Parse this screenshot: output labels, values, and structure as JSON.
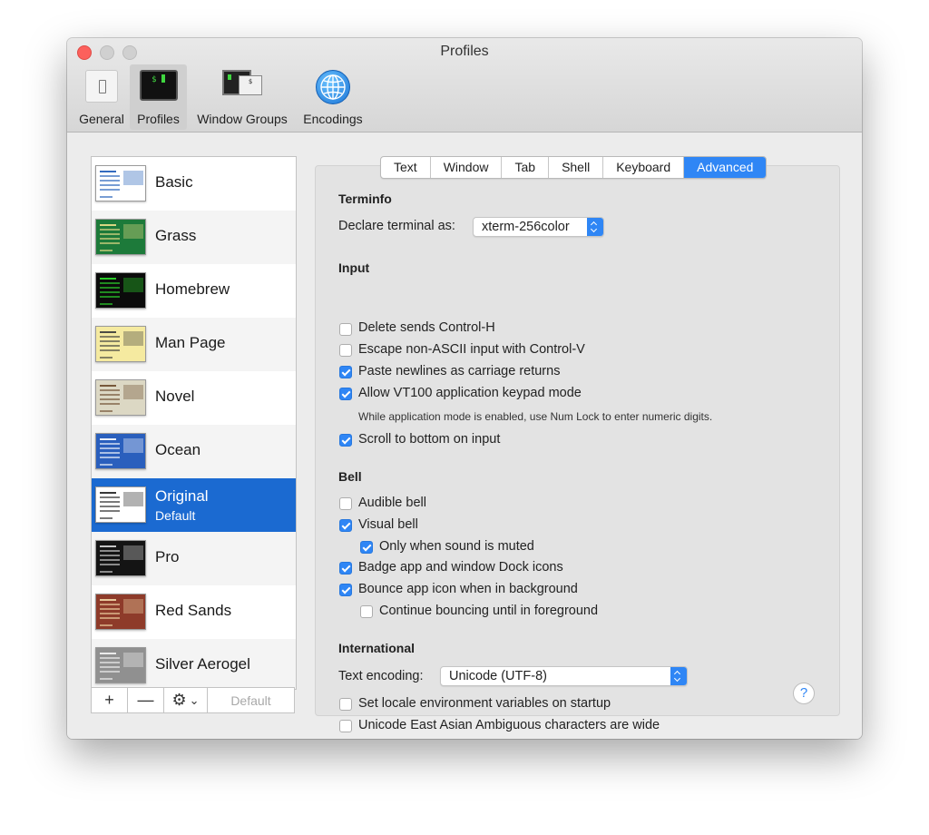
{
  "window": {
    "title": "Profiles"
  },
  "toolbar": {
    "items": [
      {
        "label": "General",
        "icon": "general-icon"
      },
      {
        "label": "Profiles",
        "icon": "terminal-icon",
        "selected": true
      },
      {
        "label": "Window Groups",
        "icon": "window-groups-icon"
      },
      {
        "label": "Encodings",
        "icon": "globe-icon"
      }
    ],
    "profiles_icon_text": "$",
    "window_groups_icon_text": "$"
  },
  "profiles": [
    {
      "name": "Basic",
      "bg": "#ffffff",
      "fg": "#1e5bb8"
    },
    {
      "name": "Grass",
      "bg": "#1d7a3a",
      "fg": "#f0e08a"
    },
    {
      "name": "Homebrew",
      "bg": "#0b0b0b",
      "fg": "#2ee02e"
    },
    {
      "name": "Man Page",
      "bg": "#f5eaa0",
      "fg": "#3b3b3b"
    },
    {
      "name": "Novel",
      "bg": "#dcd8c4",
      "fg": "#6b4a2b"
    },
    {
      "name": "Ocean",
      "bg": "#2a5fbd",
      "fg": "#ffffff"
    },
    {
      "name": "Original",
      "sub": "Default",
      "bg": "#ffffff",
      "fg": "#222222",
      "selected": true
    },
    {
      "name": "Pro",
      "bg": "#141414",
      "fg": "#d8d8d8"
    },
    {
      "name": "Red Sands",
      "bg": "#8e3b2a",
      "fg": "#f1d9a8"
    },
    {
      "name": "Silver Aerogel",
      "bg": "#909090",
      "fg": "#f5f5f5"
    }
  ],
  "list_tools": {
    "add": "+",
    "remove": "—",
    "gear": "⚙",
    "chevron": "⌄",
    "default_label": "Default"
  },
  "tabs": [
    {
      "label": "Text"
    },
    {
      "label": "Window"
    },
    {
      "label": "Tab"
    },
    {
      "label": "Shell"
    },
    {
      "label": "Keyboard"
    },
    {
      "label": "Advanced",
      "active": true
    }
  ],
  "terminfo": {
    "heading": "Terminfo",
    "declare_label": "Declare terminal as:",
    "declare_value": "xterm-256color"
  },
  "input": {
    "heading": "Input",
    "options": [
      {
        "label": "Delete sends Control-H",
        "checked": false
      },
      {
        "label": "Escape non-ASCII input with Control-V",
        "checked": false
      },
      {
        "label": "Paste newlines as carriage returns",
        "checked": true
      },
      {
        "label": "Allow VT100 application keypad mode",
        "checked": true
      },
      {
        "label": "Scroll to bottom on input",
        "checked": true
      }
    ],
    "keypad_note": "While application mode is enabled, use Num Lock to enter numeric digits."
  },
  "bell": {
    "heading": "Bell",
    "options": [
      {
        "label": "Audible bell",
        "checked": false
      },
      {
        "label": "Visual bell",
        "checked": true
      },
      {
        "label": "Only when sound is muted",
        "checked": true
      },
      {
        "label": "Badge app and window Dock icons",
        "checked": true
      },
      {
        "label": "Bounce app icon when in background",
        "checked": true
      },
      {
        "label": "Continue bouncing until in foreground",
        "checked": false
      }
    ]
  },
  "international": {
    "heading": "International",
    "encoding_label": "Text encoding:",
    "encoding_value": "Unicode (UTF-8)",
    "options": [
      {
        "label": "Set locale environment variables on startup",
        "checked": false
      },
      {
        "label": "Unicode East Asian Ambiguous characters are wide",
        "checked": false
      }
    ]
  },
  "help_label": "?",
  "colors": {
    "accent": "#2f86f5",
    "selection": "#1b6ad1",
    "close": "#fc605c"
  }
}
